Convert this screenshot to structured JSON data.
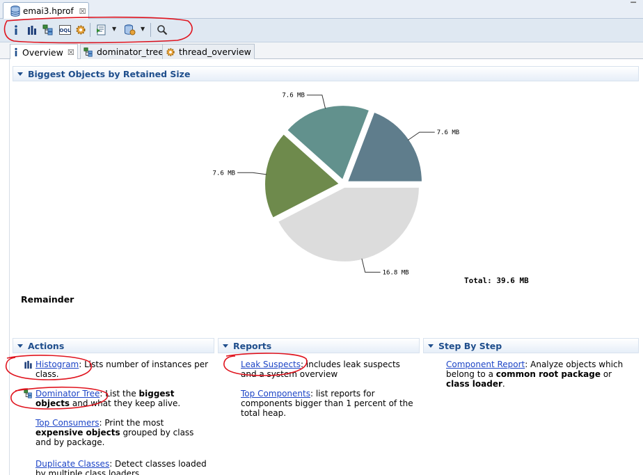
{
  "editor_tab": {
    "title": "emai3.hprof",
    "close": "☒"
  },
  "window": {
    "menu_dots": "▔"
  },
  "toolbar": {
    "buttons": [
      "info-icon",
      "histogram-icon",
      "dominator-tree-icon",
      "oql-icon",
      "thread-gear-icon",
      "run-report-icon",
      "query-browser-icon",
      "search-icon"
    ],
    "oql_text": "OQL",
    "caret": "▼"
  },
  "page_tabs": [
    {
      "label": "Overview",
      "close": "☒"
    },
    {
      "label": "dominator_tree"
    },
    {
      "label": "thread_overview"
    }
  ],
  "overview": {
    "chart_section_title": "Biggest Objects by Retained Size",
    "total_label": "Total: 39.6 MB",
    "remainder_label": "Remainder"
  },
  "chart_data": {
    "type": "pie",
    "unit": "MB",
    "slices": [
      {
        "label": "7.6 MB",
        "value": 7.6,
        "color": "#5f7d8c"
      },
      {
        "label": "7.6 MB",
        "value": 7.6,
        "color": "#62918d"
      },
      {
        "label": "7.6 MB",
        "value": 7.6,
        "color": "#6e8a4c"
      },
      {
        "label": "16.8 MB",
        "value": 16.8,
        "color": "#dcdcdc"
      }
    ],
    "total": 39.6
  },
  "actions": {
    "title": "Actions",
    "items": [
      {
        "link": "Histogram",
        "text": ": Lists number of instances per class."
      },
      {
        "link": "Dominator Tree",
        "pre": ": List the ",
        "bold": "biggest objects",
        "post": " and what they keep alive."
      },
      {
        "link": "Top Consumers",
        "pre": ": Print the most ",
        "bold": "expensive objects",
        "post": " grouped by class and by package."
      },
      {
        "link": "Duplicate Classes",
        "text": ": Detect classes loaded by multiple class loaders."
      }
    ]
  },
  "reports": {
    "title": "Reports",
    "items": [
      {
        "link": "Leak Suspects",
        "text": ": includes leak suspects and a system overview"
      },
      {
        "link": "Top Components",
        "text": ": list reports for components bigger than 1 percent of the total heap."
      }
    ]
  },
  "step_by_step": {
    "title": "Step By Step",
    "items": [
      {
        "link": "Component Report",
        "pre": ": Analyze objects which belong to a ",
        "bold": "common root package",
        "mid": " or ",
        "bold2": "class loader",
        "post": "."
      }
    ]
  },
  "colors": {
    "link": "#1c44c6",
    "section_title": "#1f4e8c",
    "annotation": "#e0141e"
  }
}
